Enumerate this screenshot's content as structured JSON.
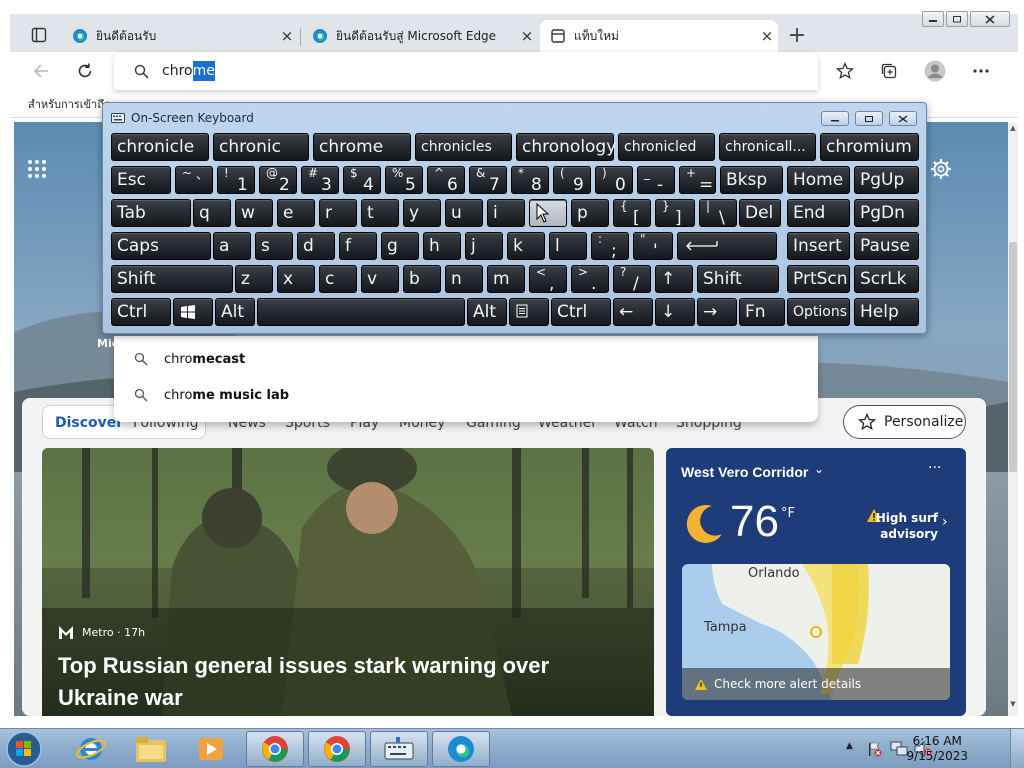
{
  "browser": {
    "tabs": [
      {
        "title": "ยินดีต้อนรับ",
        "close": "×"
      },
      {
        "title": "ยินดีต้อนรับสู่ Microsoft Edge",
        "close": "×"
      },
      {
        "title": "แท็บใหม่",
        "close": "×"
      }
    ],
    "new_tab_symbol": "+",
    "favorites_bar_text": "สำหรับการเข้าถึง"
  },
  "omnibox": {
    "typed": "chro",
    "autocomplete": "me"
  },
  "suggestions": [
    {
      "prefix": "chro",
      "rest": "mecast"
    },
    {
      "prefix": "chro",
      "rest": "me music lab"
    }
  ],
  "osk": {
    "title": "On-Screen Keyboard",
    "predictions": [
      "chronicle",
      "chronic",
      "chrome",
      "chronicles",
      "chronology",
      "chronicled",
      "chronicall...",
      "chromium"
    ],
    "row1": [
      {
        "m": "Esc"
      },
      {
        "u": "~",
        "l": "`"
      },
      {
        "u": "!",
        "l": "1"
      },
      {
        "u": "@",
        "l": "2"
      },
      {
        "u": "#",
        "l": "3"
      },
      {
        "u": "$",
        "l": "4"
      },
      {
        "u": "%",
        "l": "5"
      },
      {
        "u": "^",
        "l": "6"
      },
      {
        "u": "&",
        "l": "7"
      },
      {
        "u": "*",
        "l": "8"
      },
      {
        "u": "(",
        "l": "9"
      },
      {
        "u": ")",
        "l": "0"
      },
      {
        "u": "_",
        "l": "-"
      },
      {
        "u": "+",
        "l": "="
      },
      {
        "m": "Bksp"
      },
      {
        "m": "Home"
      },
      {
        "m": "PgUp"
      }
    ],
    "row2": [
      {
        "m": "Tab"
      },
      {
        "m": "q"
      },
      {
        "m": "w"
      },
      {
        "m": "e"
      },
      {
        "m": "r"
      },
      {
        "m": "t"
      },
      {
        "m": "y"
      },
      {
        "m": "u"
      },
      {
        "m": "i"
      },
      {
        "m": ""
      },
      {
        "m": "p"
      },
      {
        "u": "{",
        "l": "["
      },
      {
        "u": "}",
        "l": "]"
      },
      {
        "u": "|",
        "l": "\\"
      },
      {
        "m": "Del"
      },
      {
        "m": "End"
      },
      {
        "m": "PgDn"
      }
    ],
    "row3": [
      {
        "m": "Caps"
      },
      {
        "m": "a"
      },
      {
        "m": "s"
      },
      {
        "m": "d"
      },
      {
        "m": "f"
      },
      {
        "m": "g"
      },
      {
        "m": "h"
      },
      {
        "m": "j"
      },
      {
        "m": "k"
      },
      {
        "m": "l"
      },
      {
        "u": ":",
        "l": ";"
      },
      {
        "u": "\"",
        "l": "'"
      },
      {
        "m": ""
      },
      {
        "m": "Insert"
      },
      {
        "m": "Pause"
      }
    ],
    "row4": [
      {
        "m": "Shift"
      },
      {
        "m": "z"
      },
      {
        "m": "x"
      },
      {
        "m": "c"
      },
      {
        "m": "v"
      },
      {
        "m": "b"
      },
      {
        "m": "n"
      },
      {
        "m": "m"
      },
      {
        "u": "<",
        "l": ","
      },
      {
        "u": ">",
        "l": "."
      },
      {
        "u": "?",
        "l": "/"
      },
      {
        "m": "↑"
      },
      {
        "m": "Shift"
      },
      {
        "m": "PrtScn"
      },
      {
        "m": "ScrLk"
      }
    ],
    "row5": [
      {
        "m": "Ctrl"
      },
      {
        "m": ""
      },
      {
        "m": "Alt"
      },
      {
        "m": ""
      },
      {
        "m": "Alt"
      },
      {
        "m": ""
      },
      {
        "m": "Ctrl"
      },
      {
        "m": "←"
      },
      {
        "m": "↓"
      },
      {
        "m": "→"
      },
      {
        "m": "Fn"
      },
      {
        "m": "Options"
      },
      {
        "m": "Help"
      }
    ]
  },
  "newtab": {
    "partial_label": "Mic",
    "nav_tabs": [
      "Discover",
      "Following",
      "News",
      "Sports",
      "Play",
      "Money",
      "Gaming",
      "Weather",
      "Watch",
      "Shopping"
    ],
    "more": "···",
    "personalize": "Personalize",
    "article": {
      "source": "Metro · 17h",
      "headline": "Top Russian general issues stark warning over Ukraine war"
    },
    "weather": {
      "location": "West Vero Corridor",
      "temp": "76",
      "unit": "°F",
      "alert": "High surf advisory",
      "map_city1": "Orlando",
      "map_city2": "Tampa",
      "cta": "Check more alert details",
      "more": "···"
    }
  },
  "taskbar": {
    "time": "6:16 AM",
    "date": "9/15/2023"
  }
}
